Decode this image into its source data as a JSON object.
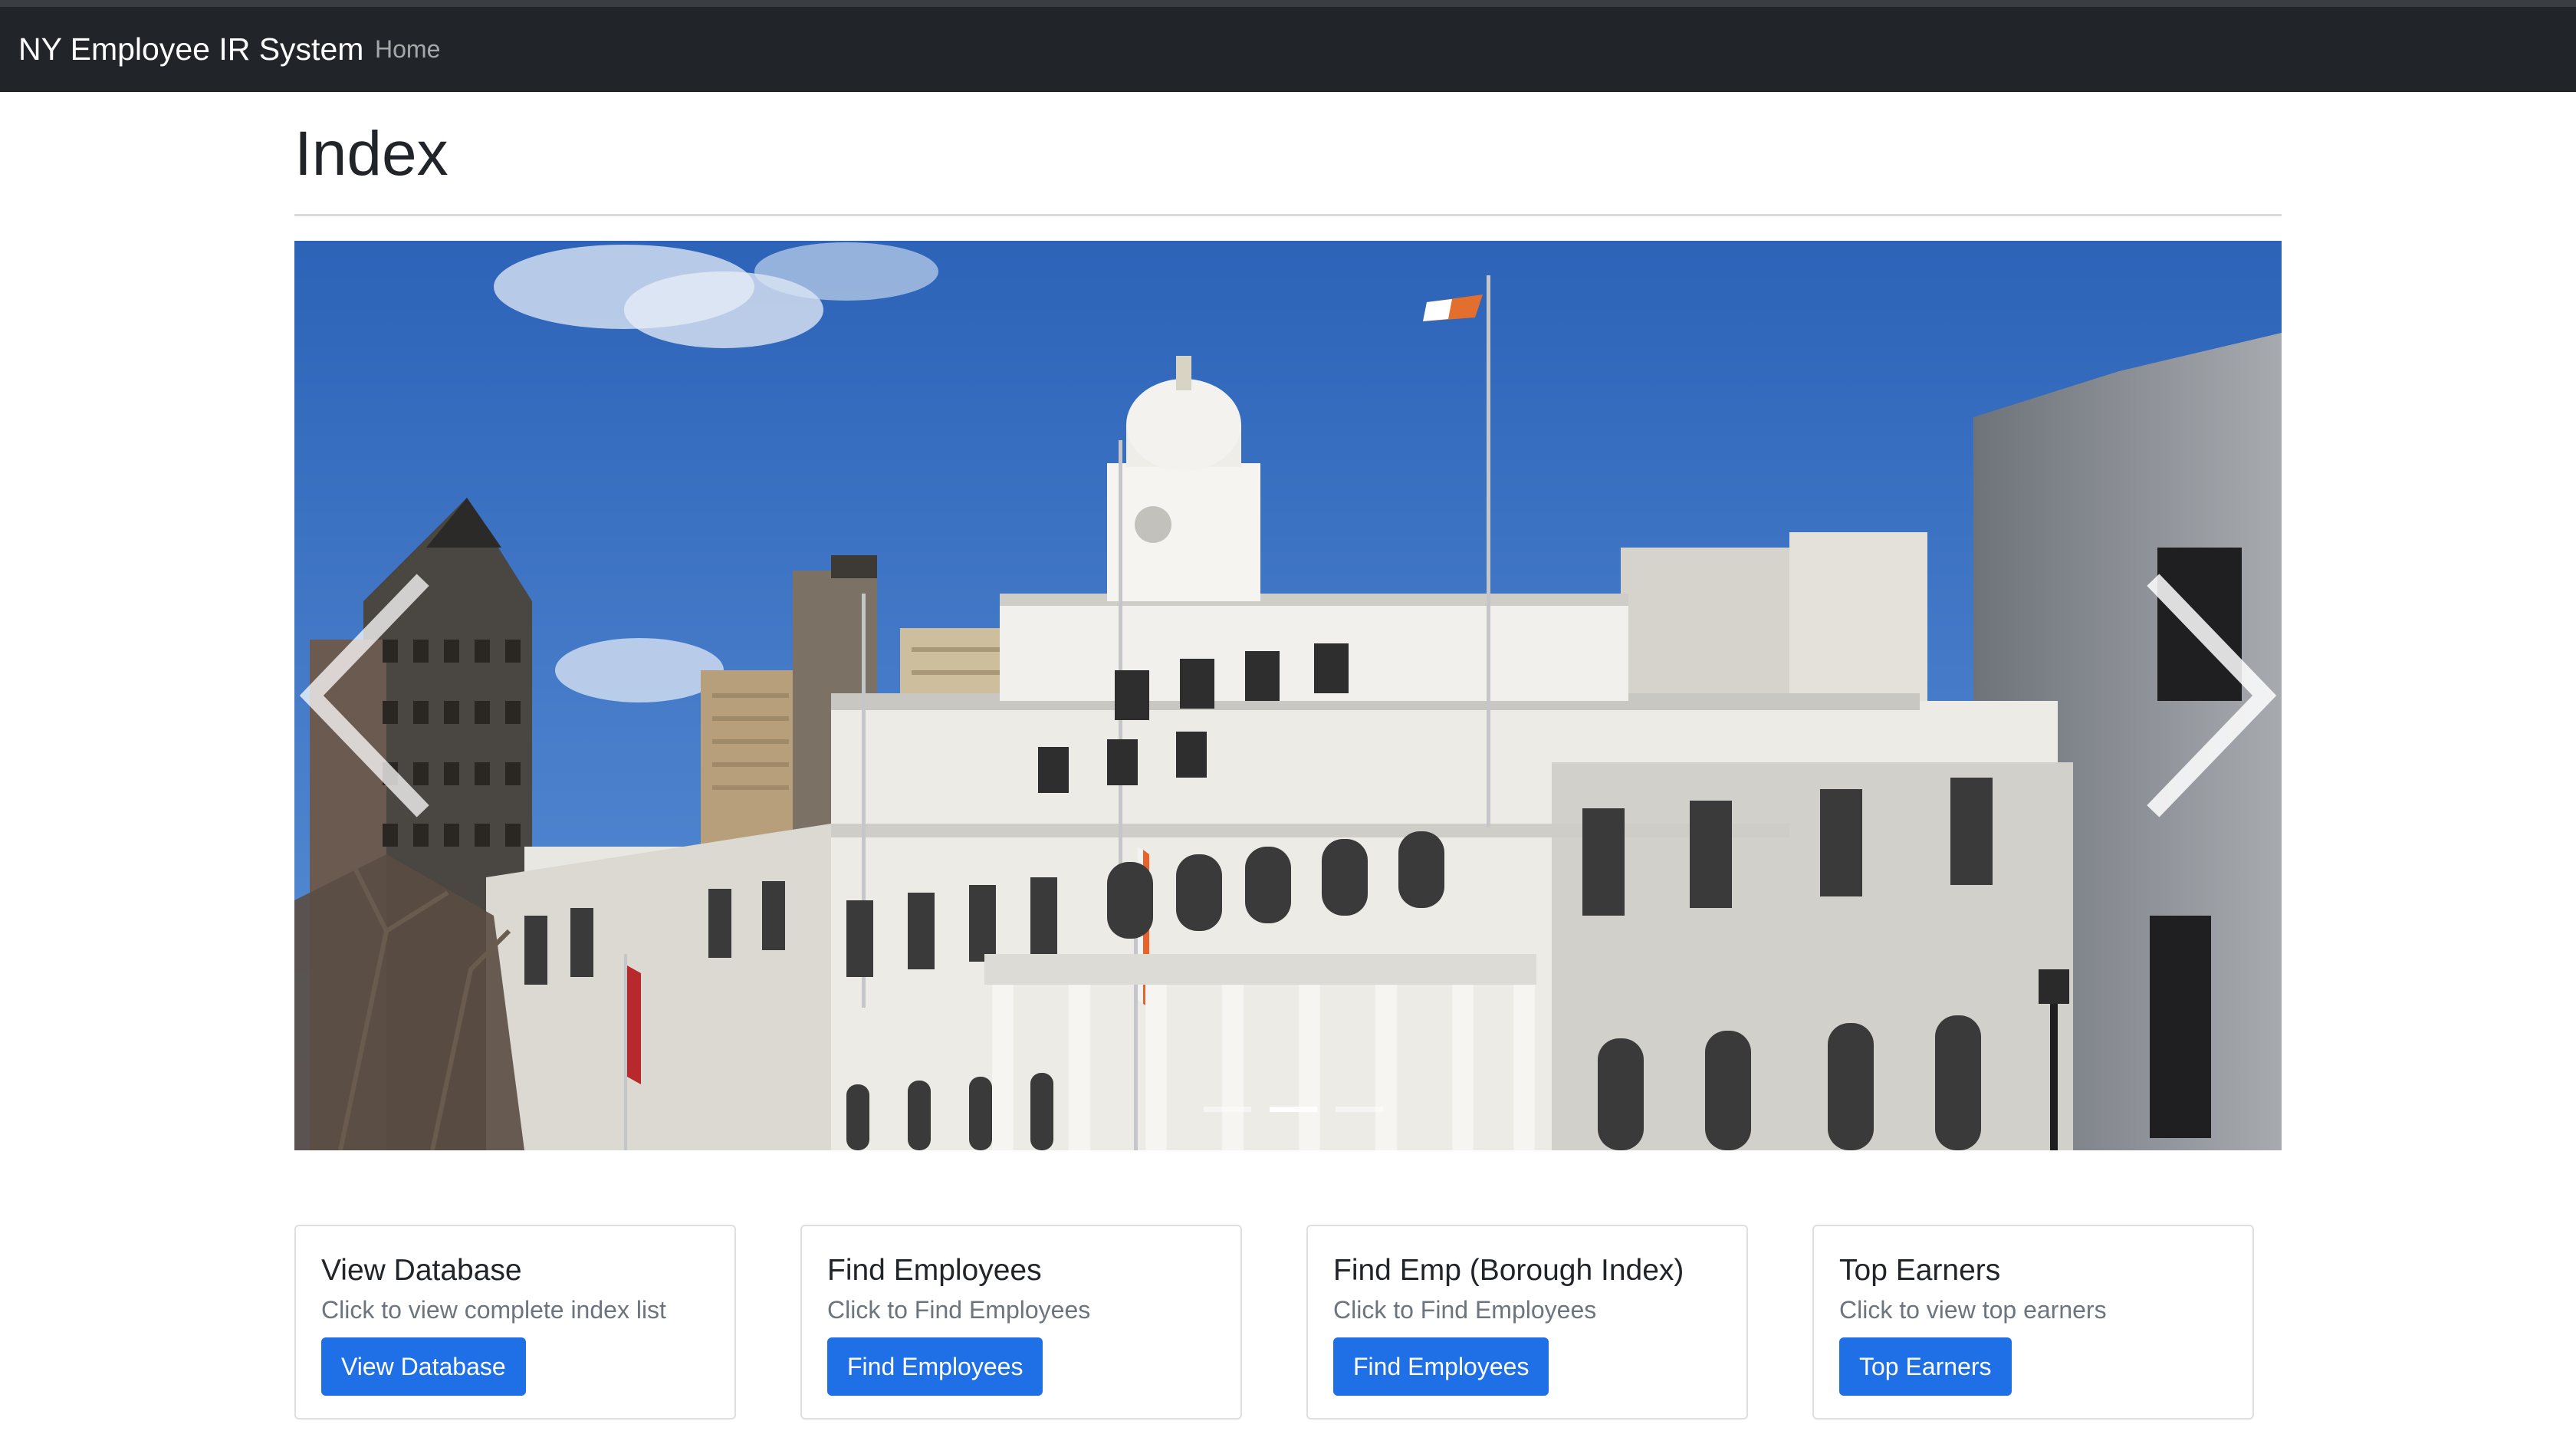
{
  "navbar": {
    "brand": "NY Employee IR System",
    "links": [
      {
        "label": "Home"
      }
    ]
  },
  "page": {
    "title": "Index"
  },
  "carousel": {
    "slides": 3,
    "active_slide": 2,
    "controls": [
      "chevron-left-icon",
      "chevron-right-icon"
    ]
  },
  "cards": [
    {
      "title": "View Database",
      "text": "Click to view complete index list",
      "button": "View Database"
    },
    {
      "title": "Find Employees",
      "text": "Click to Find Employees",
      "button": "Find Employees"
    },
    {
      "title": "Find Emp (Borough Index)",
      "text": "Click to Find Employees",
      "button": "Find Employees"
    },
    {
      "title": "Top Earners",
      "text": "Click to view top earners",
      "button": "Top Earners"
    }
  ],
  "colors": {
    "navbar": "#212529",
    "primary_button": "#1f6fe6",
    "muted_text": "#6c757d"
  }
}
